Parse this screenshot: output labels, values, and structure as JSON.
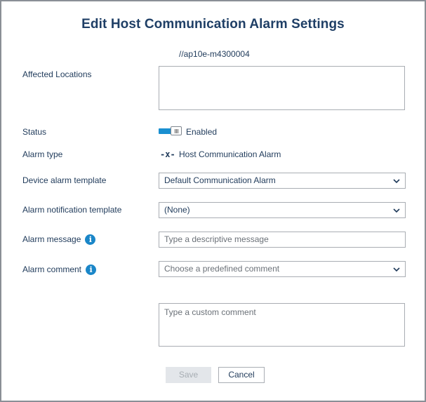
{
  "dialog": {
    "title": "Edit Host Communication Alarm Settings",
    "affected_locations": {
      "label": "Affected Locations",
      "path": "//ap10e-m4300004"
    },
    "status": {
      "label": "Status",
      "value": "Enabled",
      "enabled": true
    },
    "alarm_type": {
      "label": "Alarm type",
      "icon": "-x-",
      "value": "Host Communication Alarm"
    },
    "device_alarm_template": {
      "label": "Device alarm template",
      "value": "Default Communication Alarm"
    },
    "alarm_notification_template": {
      "label": "Alarm notification template",
      "value": "(None)"
    },
    "alarm_message": {
      "label": "Alarm message",
      "placeholder": "Type a descriptive message"
    },
    "alarm_comment": {
      "label": "Alarm comment",
      "placeholder": "Choose a predefined comment",
      "custom_placeholder": "Type a custom comment"
    },
    "buttons": {
      "save": "Save",
      "cancel": "Cancel"
    },
    "colors": {
      "accent": "#1a8fd0",
      "title": "#1f3f66",
      "text": "#1f3a5a"
    }
  }
}
